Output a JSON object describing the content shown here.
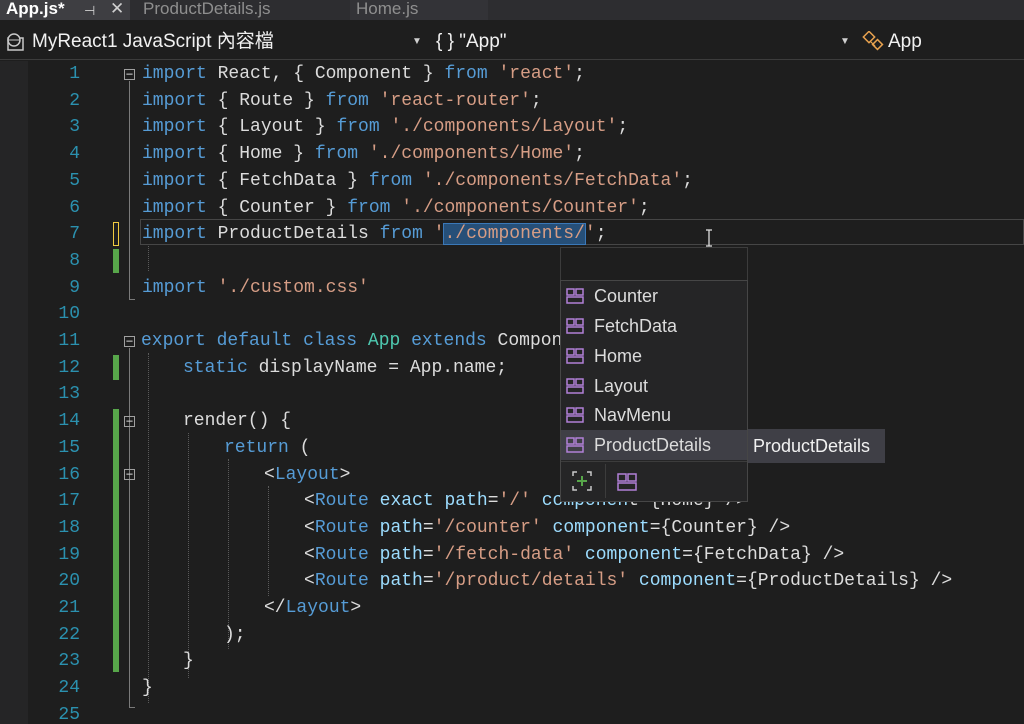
{
  "tabs": [
    {
      "label": "App.js*",
      "active": true
    },
    {
      "label": "ProductDetails.js",
      "active": false
    },
    {
      "label": "Home.js",
      "active": false
    }
  ],
  "nav": {
    "project": "MyReact1 JavaScript 內容檔",
    "scope": "{ } \"App\"",
    "member": "App"
  },
  "line_numbers": [
    "1",
    "2",
    "3",
    "4",
    "5",
    "6",
    "7",
    "8",
    "9",
    "10",
    "11",
    "12",
    "13",
    "14",
    "15",
    "16",
    "17",
    "18",
    "19",
    "20",
    "21",
    "22",
    "23",
    "24",
    "25"
  ],
  "code": {
    "l1": {
      "kw1": "import",
      "t1": " React, { Component } ",
      "kw2": "from",
      "t2": " ",
      "s1": "'react'",
      "t3": ";"
    },
    "l2": {
      "kw1": "import",
      "t1": " { Route } ",
      "kw2": "from",
      "t2": " ",
      "s1": "'react-router'",
      "t3": ";"
    },
    "l3": {
      "kw1": "import",
      "t1": " { Layout } ",
      "kw2": "from",
      "t2": " ",
      "s1": "'./components/Layout'",
      "t3": ";"
    },
    "l4": {
      "kw1": "import",
      "t1": " { Home } ",
      "kw2": "from",
      "t2": " ",
      "s1": "'./components/Home'",
      "t3": ";"
    },
    "l5": {
      "kw1": "import",
      "t1": " { FetchData } ",
      "kw2": "from",
      "t2": " ",
      "s1": "'./components/FetchData'",
      "t3": ";"
    },
    "l6": {
      "kw1": "import",
      "t1": " { Counter } ",
      "kw2": "from",
      "t2": " ",
      "s1": "'./components/Counter'",
      "t3": ";"
    },
    "l7": {
      "kw1": "import",
      "t1": " ProductDetails ",
      "kw2": "from",
      "t2": " ",
      "s1": "'",
      "sel": "./components/",
      "s2": "'",
      "t3": ";"
    },
    "l9": {
      "kw1": "import",
      "t1": " ",
      "s1": "'./custom.css'"
    },
    "l11": {
      "kw1": "export",
      "t0": " ",
      "kw2": "default",
      "t1": " ",
      "kw3": "class",
      "t2": " ",
      "c1": "App",
      "t3": " ",
      "kw4": "extends",
      "t4": " Componen"
    },
    "l12": {
      "kw1": "static",
      "t1": " displayName = App.name;"
    },
    "l14": {
      "t1": "render() {"
    },
    "l15": {
      "kw1": "return",
      "t1": " ("
    },
    "l16": {
      "t1": "<",
      "tg": "Layout",
      "t2": ">"
    },
    "l17": {
      "t1": "<",
      "tg": "Route",
      "t2": " ",
      "a1": "exact",
      "t3": " ",
      "a2": "path",
      "t4": "=",
      "s1": "'/'",
      "t5": " ",
      "a3": "componen",
      "t6": "t={Home} />"
    },
    "l18": {
      "t1": "<",
      "tg": "Route",
      "t2": " ",
      "a1": "path",
      "t3": "=",
      "s1": "'/counter'",
      "t4": " ",
      "a2": "component",
      "t5": "={Counter} />"
    },
    "l19": {
      "t1": "<",
      "tg": "Route",
      "t2": " ",
      "a1": "path",
      "t3": "=",
      "s1": "'/fetch-data'",
      "t4": " ",
      "a2": "component",
      "t5": "={FetchData} />"
    },
    "l20": {
      "t1": "<",
      "tg": "Route",
      "t2": " ",
      "a1": "path",
      "t3": "=",
      "s1": "'/product/details'",
      "t4": " ",
      "a2": "component",
      "t5": "={ProductDetails} />"
    },
    "l21": {
      "t1": "</",
      "tg": "Layout",
      "t2": ">"
    },
    "l22": {
      "t1": ");"
    },
    "l23": {
      "t1": "}"
    },
    "l24": {
      "t1": "}"
    }
  },
  "completion": {
    "items": [
      "Counter",
      "FetchData",
      "Home",
      "Layout",
      "NavMenu",
      "ProductDetails"
    ],
    "selected": "ProductDetails",
    "tooltip": "ProductDetails"
  },
  "colors": {
    "keyword": "#569cd6",
    "string": "#d69d85",
    "type": "#4ec9b0",
    "attribute": "#9cdcfe",
    "line_number": "#2b91af",
    "change_saved": "#57a64a",
    "change_unsaved": "#efc940",
    "selection": "#264f78"
  },
  "icons": {
    "item": "module-icon",
    "filter_add": "add-filter-icon",
    "filter_module": "module-filter-icon",
    "caret": "text-cursor-icon"
  }
}
